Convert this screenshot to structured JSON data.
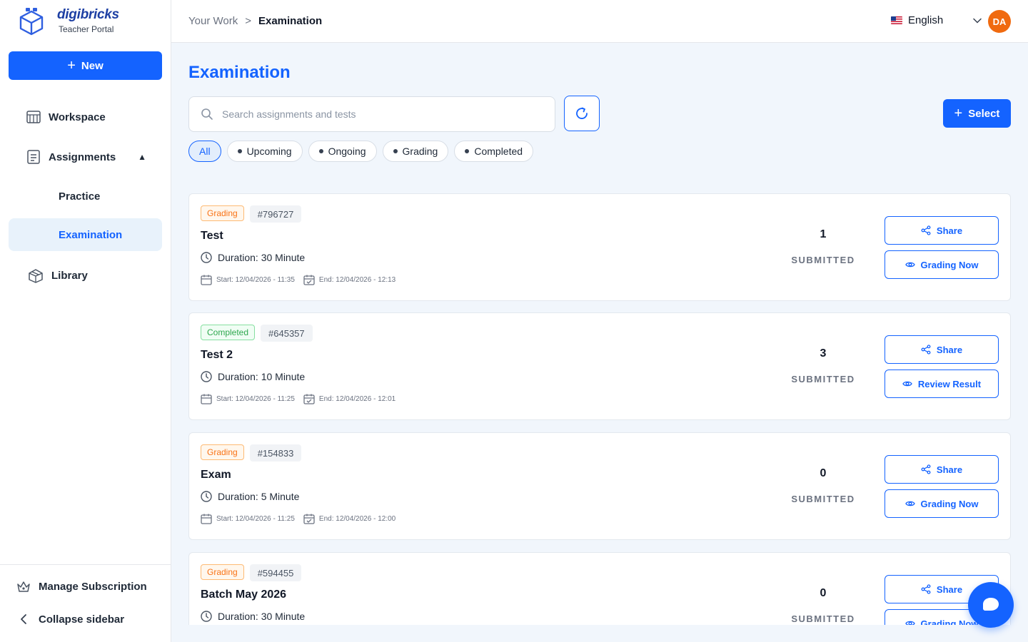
{
  "brand": {
    "name": "digibricks",
    "subtitle": "Teacher Portal"
  },
  "sidebar": {
    "new_label": "New",
    "items": [
      {
        "label": "Workspace",
        "icon": "workspace-icon"
      },
      {
        "label": "Assignments",
        "icon": "assignments-icon",
        "expanded": true
      },
      {
        "label": "Practice"
      },
      {
        "label": "Examination",
        "active": true
      },
      {
        "label": "Library",
        "icon": "library-icon"
      }
    ],
    "manage_subscription": "Manage Subscription",
    "collapse": "Collapse sidebar"
  },
  "header": {
    "breadcrumb": [
      "Your Work",
      ">",
      "Examination"
    ],
    "language": "English",
    "avatar_initials": "DA"
  },
  "main": {
    "title": "Examination",
    "search_placeholder": "Search assignments and tests",
    "select_label": "Select",
    "filters": [
      "All",
      "Upcoming",
      "Ongoing",
      "Grading",
      "Completed"
    ],
    "active_filter": "All",
    "cards": [
      {
        "status": "Grading",
        "code": "#796727",
        "title": "Test",
        "duration": "Duration: 30 Minute",
        "start": "Start: 12/04/2026 - 11:35",
        "end": "End: 12/04/2026 - 12:13",
        "count": "1",
        "count_label": "SUBMITTED",
        "share": "Share",
        "action": "Grading Now"
      },
      {
        "status": "Completed",
        "code": "#645357",
        "title": "Test 2",
        "duration": "Duration: 10 Minute",
        "start": "Start: 12/04/2026 - 11:25",
        "end": "End: 12/04/2026 - 12:01",
        "count": "3",
        "count_label": "SUBMITTED",
        "share": "Share",
        "action": "Review Result"
      },
      {
        "status": "Grading",
        "code": "#154833",
        "title": "Exam",
        "duration": "Duration: 5 Minute",
        "start": "Start: 12/04/2026 - 11:25",
        "end": "End: 12/04/2026 - 12:00",
        "count": "0",
        "count_label": "SUBMITTED",
        "share": "Share",
        "action": "Grading Now"
      },
      {
        "status": "Grading",
        "code": "#594455",
        "title": "Batch May 2026",
        "duration": "Duration: 30 Minute",
        "count": "0",
        "count_label": "SUBMITTED",
        "share": "Share",
        "action": "Grading Now"
      }
    ]
  },
  "colors": {
    "primary": "#1463ff",
    "grading": "#f97316",
    "completed": "#2fa84f",
    "avatar": "#f06a0f"
  }
}
